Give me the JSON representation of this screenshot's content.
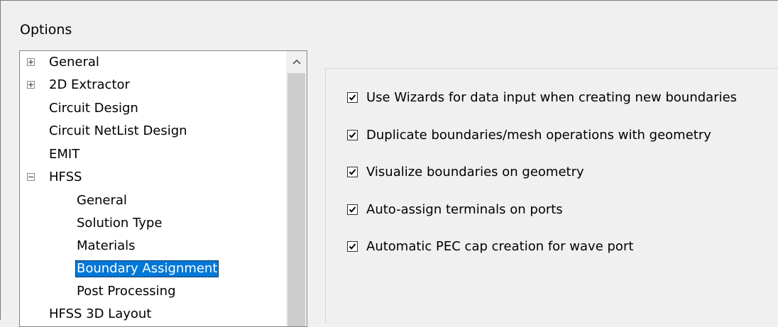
{
  "window": {
    "title": "Options"
  },
  "tree": {
    "items": [
      {
        "label": "General",
        "expander": "plus"
      },
      {
        "label": "2D Extractor",
        "expander": "plus"
      },
      {
        "label": "Circuit Design",
        "expander": ""
      },
      {
        "label": "Circuit NetList Design",
        "expander": ""
      },
      {
        "label": "EMIT",
        "expander": ""
      },
      {
        "label": "HFSS",
        "expander": "minus"
      },
      {
        "label": "General",
        "expander": ""
      },
      {
        "label": "Solution Type",
        "expander": ""
      },
      {
        "label": "Materials",
        "expander": ""
      },
      {
        "label": "Boundary Assignment",
        "expander": "",
        "selected": true
      },
      {
        "label": "Post Processing",
        "expander": ""
      },
      {
        "label": "HFSS 3D Layout",
        "expander": ""
      }
    ]
  },
  "options": [
    {
      "label": "Use Wizards for data input when creating new boundaries",
      "checked": true
    },
    {
      "label": "Duplicate boundaries/mesh operations with geometry",
      "checked": true
    },
    {
      "label": "Visualize boundaries on geometry",
      "checked": true
    },
    {
      "label": "Auto-assign terminals on ports",
      "checked": true
    },
    {
      "label": "Automatic PEC cap creation for wave port",
      "checked": true
    }
  ],
  "colors": {
    "selection": "#0078d7",
    "background": "#f0f0f0"
  },
  "icons": {
    "scroll_up": "chevron-up-icon",
    "check": "checkmark-icon",
    "expander": "tree-expander-icon"
  }
}
